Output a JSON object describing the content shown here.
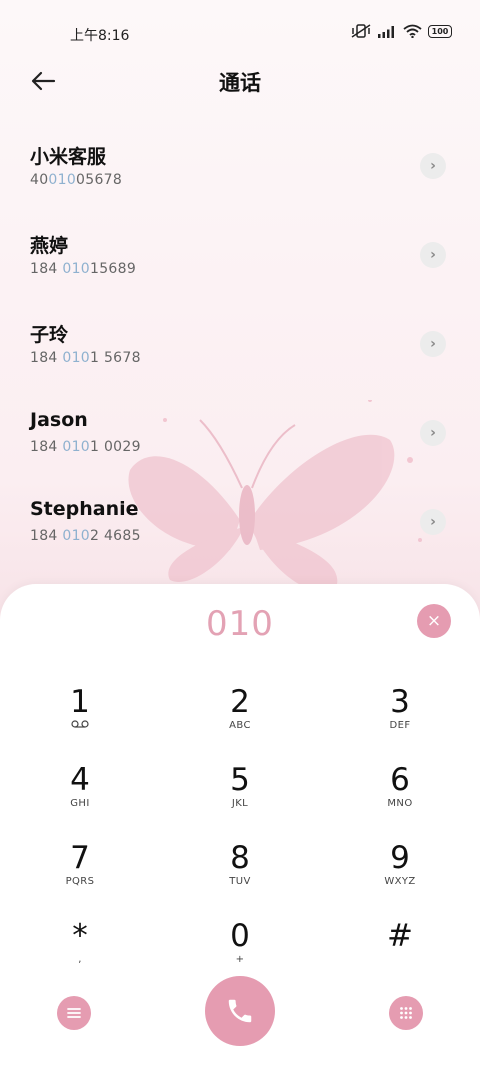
{
  "status": {
    "time": "上午8:16",
    "battery": "100"
  },
  "header": {
    "title": "通话"
  },
  "contacts": [
    {
      "name": "小米客服",
      "num_pre": "40",
      "num_hl": "010",
      "num_post": "05678"
    },
    {
      "name": "燕婷",
      "num_pre": "184 ",
      "num_hl": "010",
      "num_post": "15689"
    },
    {
      "name": "子玲",
      "num_pre": "184 ",
      "num_hl": "010",
      "num_post": "1 5678"
    },
    {
      "name": "Jason",
      "num_pre": "184 ",
      "num_hl": "010",
      "num_post": "1 0029"
    },
    {
      "name": "Stephanie",
      "num_pre": "184 ",
      "num_hl": "010",
      "num_post": "2 4685"
    }
  ],
  "dialer": {
    "input": "010",
    "clear_symbol": "×",
    "keys": [
      {
        "digit": "1",
        "letters": "ꝏ"
      },
      {
        "digit": "2",
        "letters": "ABC"
      },
      {
        "digit": "3",
        "letters": "DEF"
      },
      {
        "digit": "4",
        "letters": "GHI"
      },
      {
        "digit": "5",
        "letters": "JKL"
      },
      {
        "digit": "6",
        "letters": "MNO"
      },
      {
        "digit": "7",
        "letters": "PQRS"
      },
      {
        "digit": "8",
        "letters": "TUV"
      },
      {
        "digit": "9",
        "letters": "WXYZ"
      },
      {
        "digit": "*",
        "letters": ","
      },
      {
        "digit": "0",
        "letters": "+"
      },
      {
        "digit": "#",
        "letters": ""
      }
    ]
  },
  "colors": {
    "accent": "#e59cb1",
    "highlight": "#8fb1cf",
    "digits": "#e3a2b4"
  },
  "icons": {
    "back": "arrow-left-icon",
    "menu": "menu-icon",
    "call": "phone-icon",
    "keypad": "keypad-icon"
  }
}
